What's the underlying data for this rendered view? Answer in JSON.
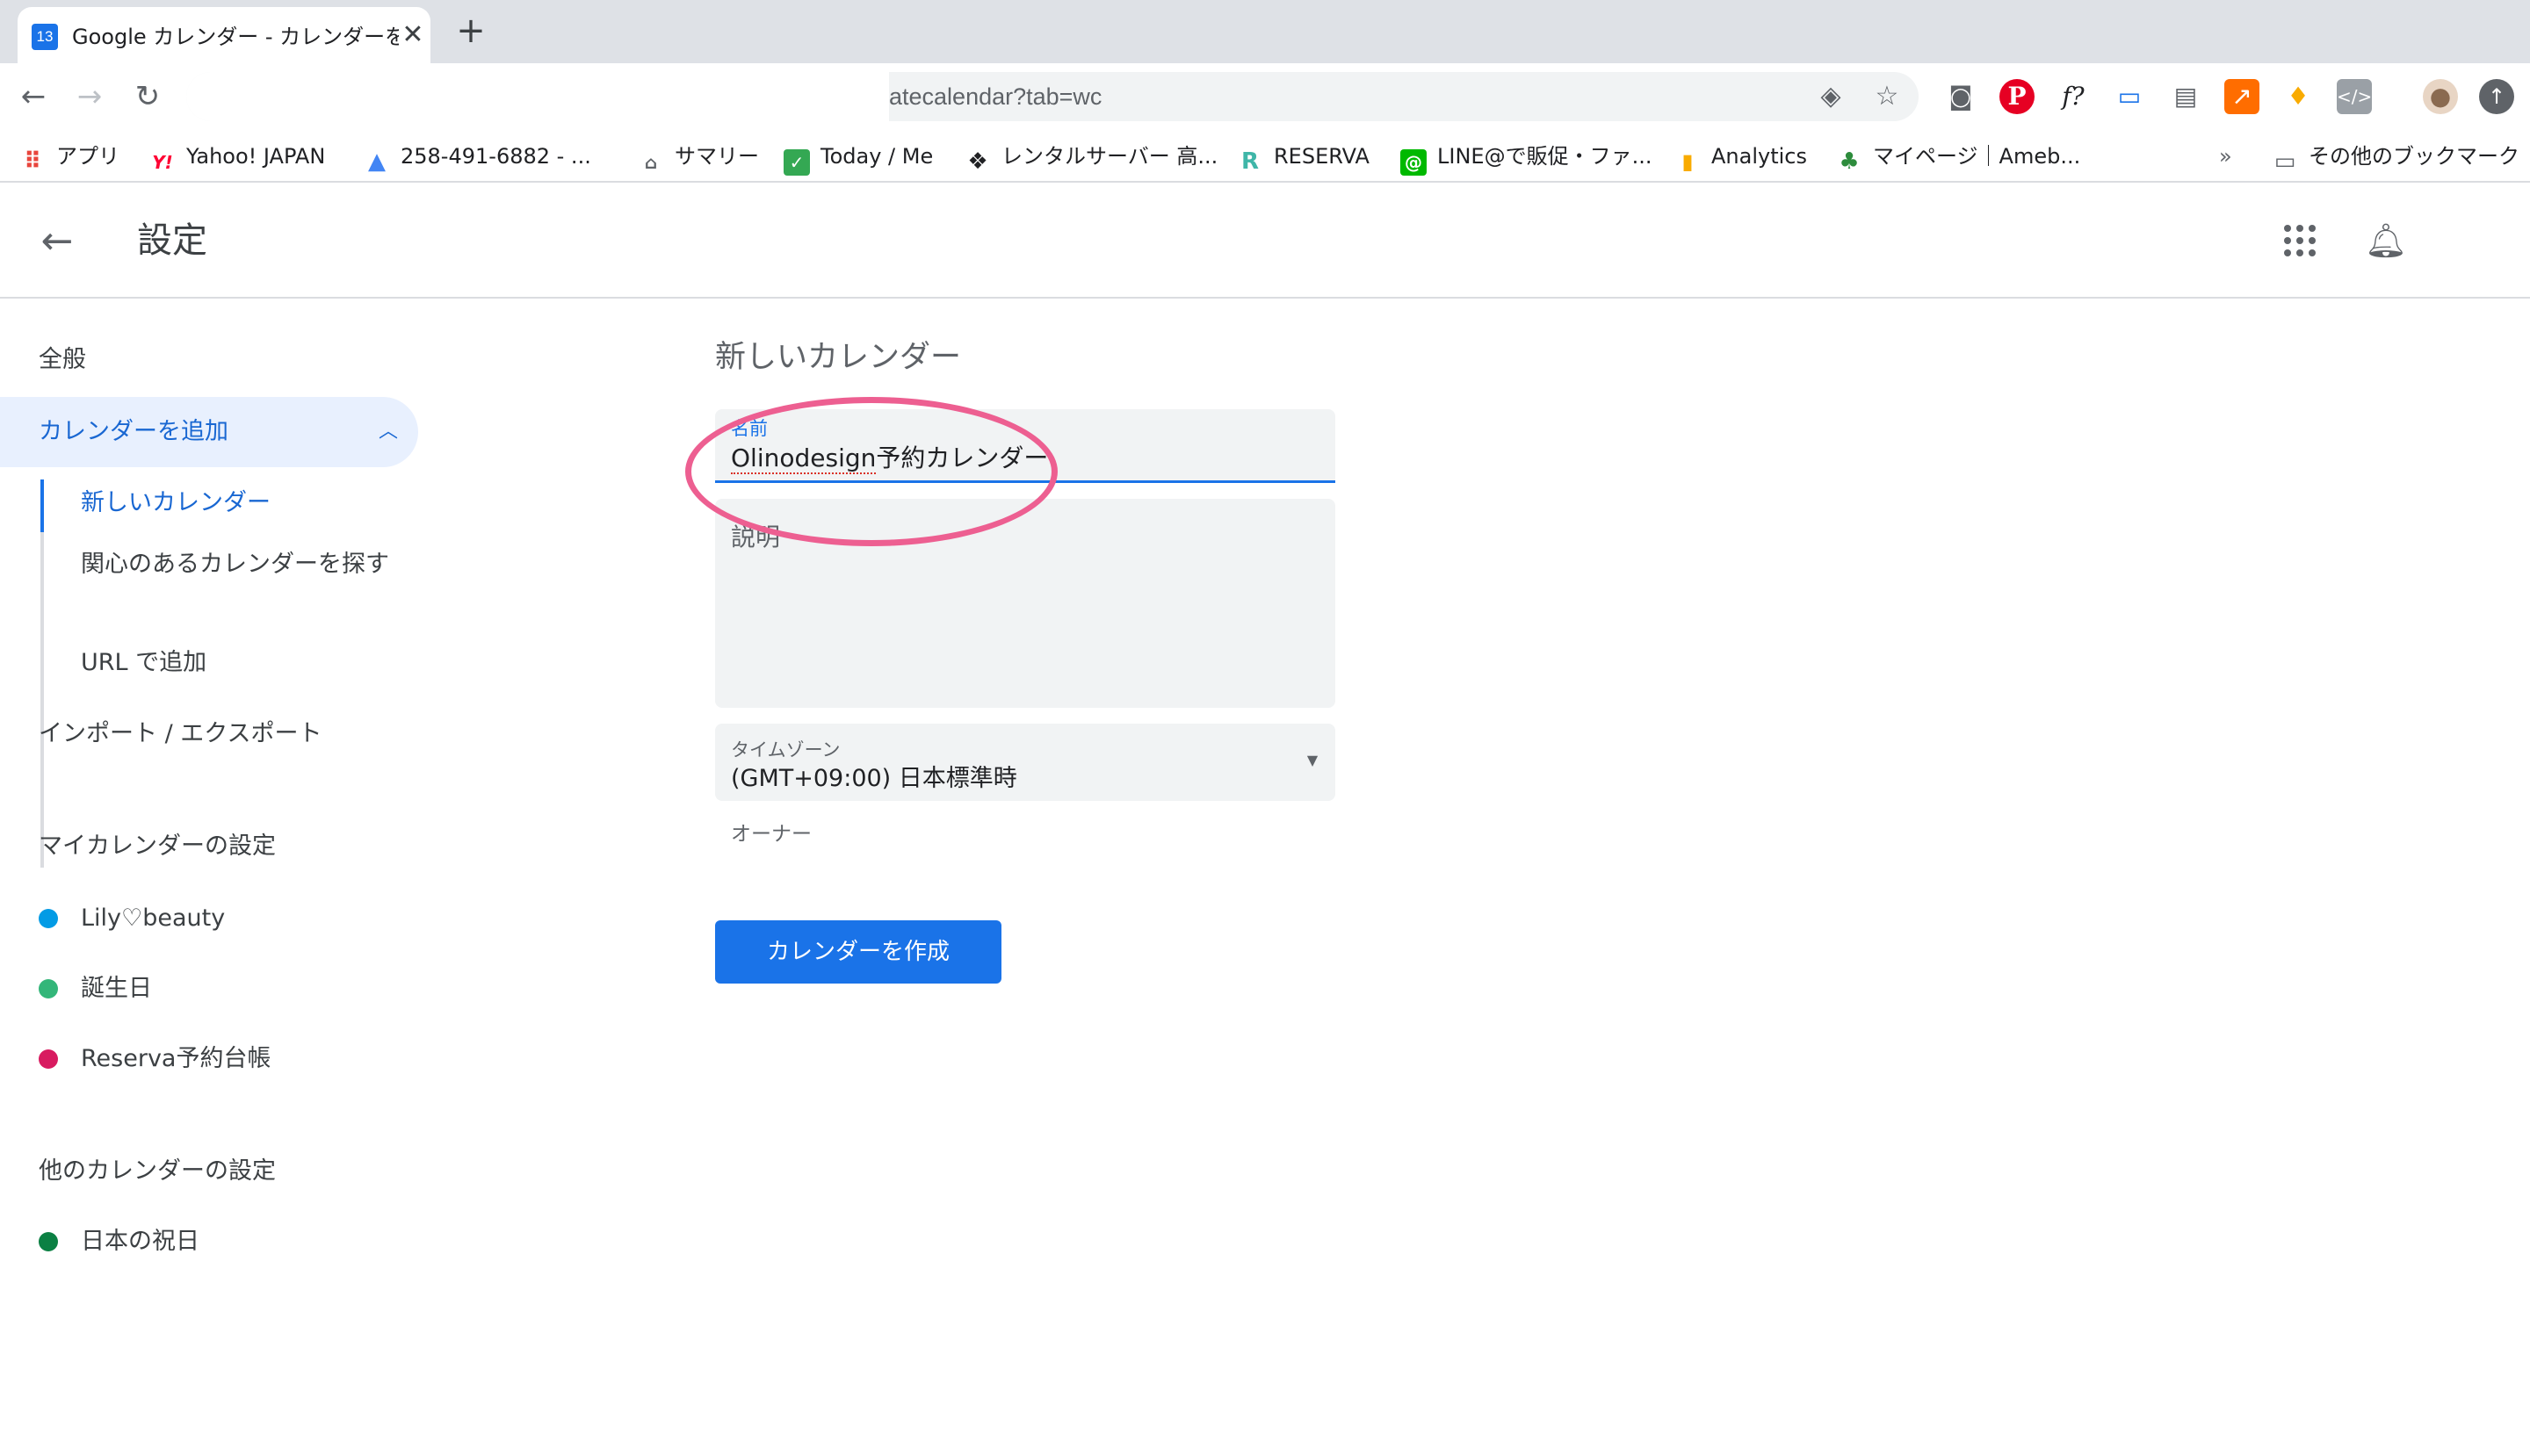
{
  "browser": {
    "tab": {
      "favicon_text": "13",
      "title": "Google カレンダー - カレンダーを",
      "close": "✕"
    },
    "new_tab": "+",
    "nav": {
      "back": "←",
      "forward": "→",
      "reload": "↻"
    },
    "address": {
      "url_visible": "atecalendar?tab=wc"
    },
    "bookmarks": [
      {
        "label": "アプリ",
        "icon": "apps-grid-icon",
        "color": "#e8453c"
      },
      {
        "label": "Yahoo! JAPAN",
        "icon": "yahoo-icon",
        "color": "#ff0033"
      },
      {
        "label": "258-491-6882 - ...",
        "icon": "google-ads-icon",
        "color": "#4285f4"
      },
      {
        "label": "サマリー",
        "icon": "summary-icon",
        "color": "#5f6368"
      },
      {
        "label": "Today / Me",
        "icon": "today-icon",
        "color": "#34a853"
      },
      {
        "label": "レンタルサーバー 高...",
        "icon": "server-icon",
        "color": "#202124"
      },
      {
        "label": "RESERVA",
        "icon": "reserva-icon",
        "color": "#3fb6a8"
      },
      {
        "label": "LINE@で販促・ファ...",
        "icon": "line-icon",
        "color": "#00b900"
      },
      {
        "label": "Analytics",
        "icon": "analytics-icon",
        "color": "#f9ab00"
      },
      {
        "label": "マイページ｜Ameb...",
        "icon": "ameba-icon",
        "color": "#2d8c3c"
      }
    ],
    "bookmarks_overflow": "»",
    "other_bookmarks": "その他のブックマーク"
  },
  "header": {
    "back": "←",
    "title": "設定"
  },
  "sidebar": {
    "general": "全般",
    "add_calendar": "カレンダーを追加",
    "chevron": "︿",
    "sub_items": [
      "新しいカレンダー",
      "関心のあるカレンダーを探す",
      "URL で追加"
    ],
    "import_export": "インポート / エクスポート",
    "my_calendars_title": "マイカレンダーの設定",
    "my_calendars": [
      {
        "label": "Lily♡beauty",
        "color": "#039be5"
      },
      {
        "label": "誕生日",
        "color": "#33b679"
      },
      {
        "label": "Reserva予約台帳",
        "color": "#d81b60"
      }
    ],
    "other_calendars_title": "他のカレンダーの設定",
    "other_calendars": [
      {
        "label": "日本の祝日",
        "color": "#0b8043"
      }
    ]
  },
  "form": {
    "heading": "新しいカレンダー",
    "name_label": "名前",
    "name_value_misspelled": "Olinodesign",
    "name_value_rest": "予約カレンダー",
    "description_placeholder": "説明",
    "timezone_label": "タイムゾーン",
    "timezone_value": "(GMT+09:00) 日本標準時",
    "owner_label": "オーナー",
    "create_button": "カレンダーを作成"
  },
  "colors": {
    "accent": "#1a73e8",
    "annotation": "#ed5f91"
  }
}
